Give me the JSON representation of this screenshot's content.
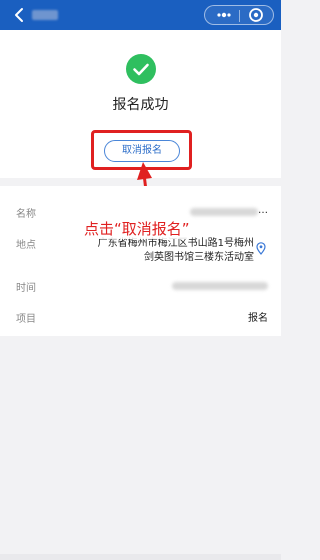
{
  "status": {
    "text": "报名成功",
    "accent": "#2fbf5f"
  },
  "actions": {
    "cancel_label": "取消报名"
  },
  "details": {
    "name_label": "名称",
    "name_value_tail": "…",
    "location_label": "地点",
    "location_line1": "广东省梅州市梅江区书山路1号梅州",
    "location_line2": "剑英图书馆三楼东活动室",
    "time_label": "时间",
    "item_label": "项目",
    "item_value": "报名"
  },
  "annotation": {
    "text": "点击“取消报名”",
    "color": "#e02020"
  },
  "icons": {
    "back": "back-chevron-icon",
    "more": "more-dots-icon",
    "close": "close-circle-icon",
    "success": "check-circle-icon",
    "location": "map-pin-icon"
  },
  "colors": {
    "nav": "#1a5fc0",
    "button_border": "#4a86d8"
  }
}
